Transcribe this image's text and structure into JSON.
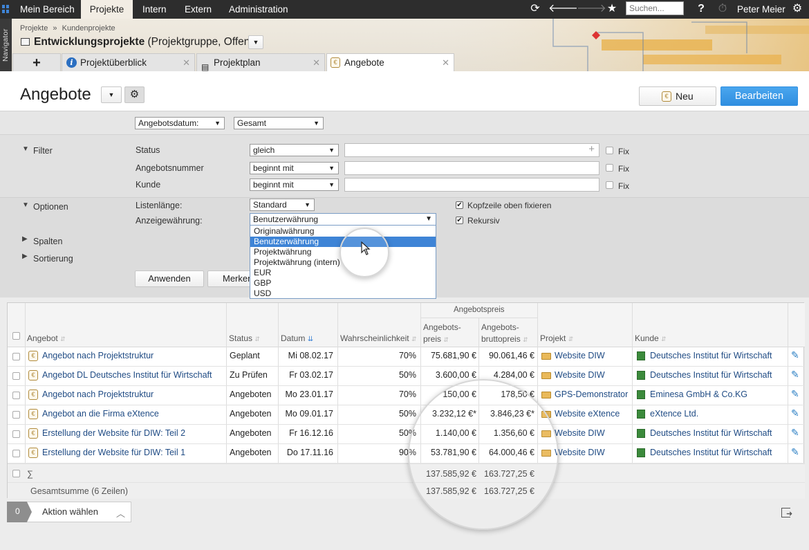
{
  "topnav": {
    "items": [
      "Mein Bereich",
      "Projekte",
      "Intern",
      "Extern",
      "Administration"
    ],
    "search_placeholder": "Suchen...",
    "help": "?",
    "user": "Peter Meier"
  },
  "navigator_label": "Navigator",
  "breadcrumb": [
    "Projekte",
    "Kundenprojekte"
  ],
  "breadcrumb_sep": "»",
  "project_title": {
    "name": "Entwicklungsprojekte",
    "suffix": "(Projektgruppe, Offen)"
  },
  "tabs": [
    {
      "label": "Projektüberblick"
    },
    {
      "label": "Projektplan"
    },
    {
      "label": "Angebote"
    }
  ],
  "page": {
    "title": "Angebote",
    "new_label": "Neu",
    "edit_label": "Bearbeiten"
  },
  "period": {
    "date_field": "Angebotsdatum:",
    "range": "Gesamt"
  },
  "filter": {
    "title": "Filter",
    "rows": [
      {
        "label": "Status",
        "op": "gleich",
        "fix": "Fix"
      },
      {
        "label": "Angebotsnummer",
        "op": "beginnt mit",
        "fix": "Fix"
      },
      {
        "label": "Kunde",
        "op": "beginnt mit",
        "fix": "Fix"
      }
    ]
  },
  "options": {
    "title": "Optionen",
    "list_length_label": "Listenlänge:",
    "list_length": "Standard",
    "currency_label": "Anzeigewährung:",
    "currency": "Benutzerwährung",
    "freeze_header": "Kopfzeile oben fixieren",
    "recursive": "Rekursiv"
  },
  "dropdown_options": [
    "Originalwährung",
    "Benutzerwährung",
    "Projektwährung",
    "Projektwährung (intern)",
    "EUR",
    "GBP",
    "USD"
  ],
  "sections": {
    "columns": "Spalten",
    "sorting": "Sortierung"
  },
  "actions": {
    "apply": "Anwenden",
    "remember": "Merken"
  },
  "table": {
    "group_header": "Angebotspreis",
    "columns": {
      "offer": "Angebot",
      "status": "Status",
      "date": "Datum",
      "probability": "Wahrscheinlichkeit",
      "price_l1": "Angebots-",
      "price_l2": "preis",
      "gross_l1": "Angebots-",
      "gross_l2": "bruttopreis",
      "project": "Projekt",
      "customer": "Kunde"
    },
    "rows": [
      {
        "offer": "Angebot nach Projektstruktur",
        "status": "Geplant",
        "date": "Mi 08.02.17",
        "probability": "70%",
        "price": "75.681,90 €",
        "gross": "90.061,46 €",
        "project": "Website DIW",
        "customer": "Deutsches Institut für Wirtschaft"
      },
      {
        "offer": "Angebot DL Deutsches Institut für Wirtschaft",
        "status": "Zu Prüfen",
        "date": "Fr 03.02.17",
        "probability": "50%",
        "price": "3.600,00 €",
        "gross": "4.284,00 €",
        "project": "Website DIW",
        "customer": "Deutsches Institut für Wirtschaft"
      },
      {
        "offer": "Angebot nach Projektstruktur",
        "status": "Angeboten",
        "date": "Mo 23.01.17",
        "probability": "70%",
        "price": "150,00 €",
        "gross": "178,50 €",
        "project": "GPS-Demonstrator",
        "customer": "Eminesa GmbH & Co.KG"
      },
      {
        "offer": "Angebot an die Firma eXtence",
        "status": "Angeboten",
        "date": "Mo 09.01.17",
        "probability": "50%",
        "price": "3.232,12 €*",
        "gross": "3.846,23 €*",
        "project": "Website eXtence",
        "customer": "eXtence Ltd."
      },
      {
        "offer": "Erstellung der Website für DIW: Teil 2",
        "status": "Angeboten",
        "date": "Fr 16.12.16",
        "probability": "50%",
        "price": "1.140,00 €",
        "gross": "1.356,60 €",
        "project": "Website DIW",
        "customer": "Deutsches Institut für Wirtschaft"
      },
      {
        "offer": "Erstellung der Website für DIW: Teil 1",
        "status": "Angeboten",
        "date": "Do 17.11.16",
        "probability": "90%",
        "price": "53.781,90 €",
        "gross": "64.000,46 €",
        "project": "Website DIW",
        "customer": "Deutsches Institut für Wirtschaft"
      }
    ],
    "sum_symbol": "∑",
    "sum_price": "137.585,92 €",
    "sum_gross": "163.727,25 €",
    "total_label": "Gesamtsumme (6 Zeilen)",
    "total_price": "137.585,92 €",
    "total_gross": "163.727,25 €"
  },
  "footer": {
    "count": "0",
    "action": "Aktion wählen"
  }
}
